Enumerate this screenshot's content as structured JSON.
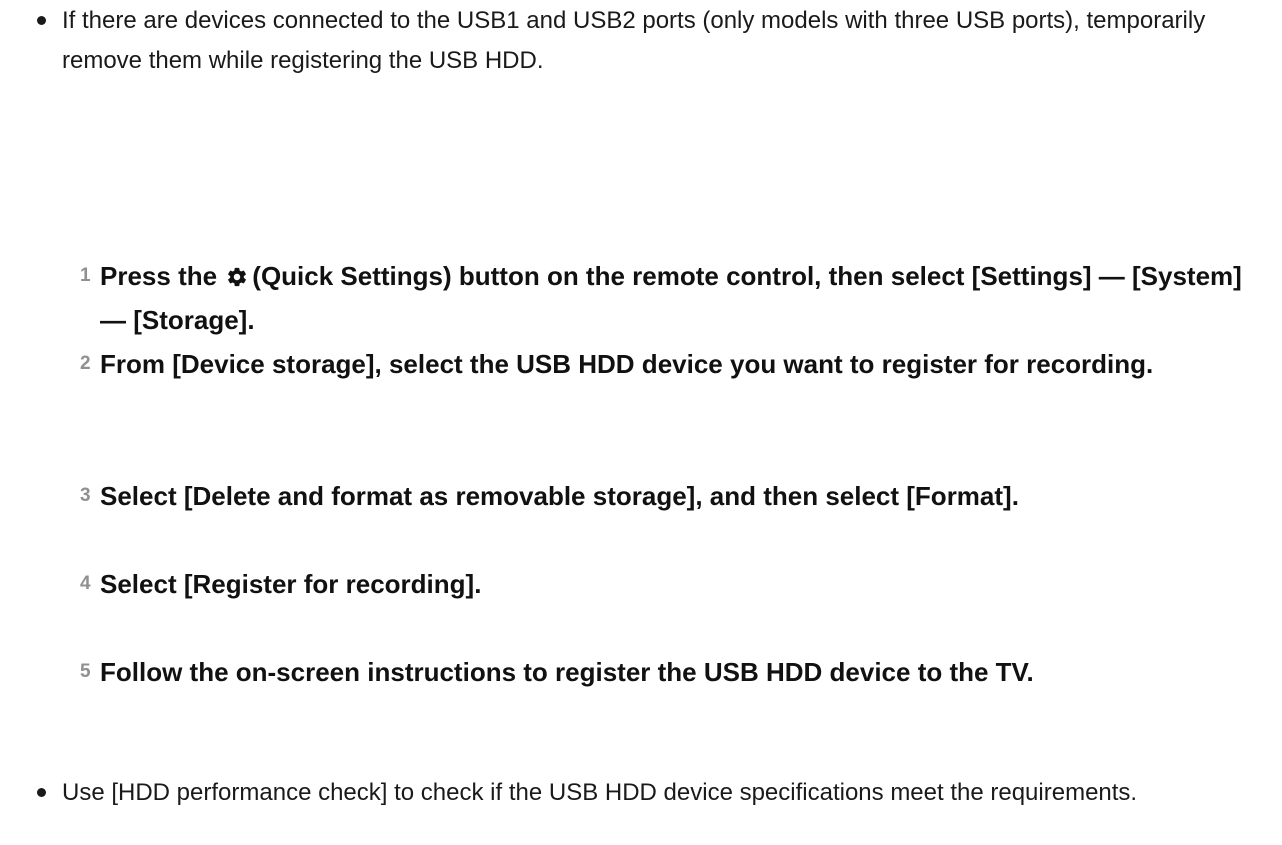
{
  "notes": [
    {
      "text": "If there are devices connected to the USB1 and USB2 ports (only models with three USB ports), temporarily remove them while registering the USB HDD."
    },
    {
      "text": "Use [HDD performance check] to check if the USB HDD device specifications meet the requirements."
    }
  ],
  "steps": [
    {
      "number": "1",
      "text_before_icon": "Press the ",
      "icon": "gear-icon",
      "text_after_icon": "(Quick Settings) button on the remote control, then select [Settings] — [System] — [Storage]."
    },
    {
      "number": "2",
      "text": "From [Device storage], select the USB HDD device you want to register for recording."
    },
    {
      "number": "3",
      "text": "Select [Delete and format as removable storage], and then select [Format]."
    },
    {
      "number": "4",
      "text": "Select [Register for recording]."
    },
    {
      "number": "5",
      "text": "Follow the on-screen instructions to register the USB HDD device to the TV."
    }
  ],
  "colors": {
    "text": "#111111",
    "step_number": "#909090",
    "background": "#ffffff"
  }
}
